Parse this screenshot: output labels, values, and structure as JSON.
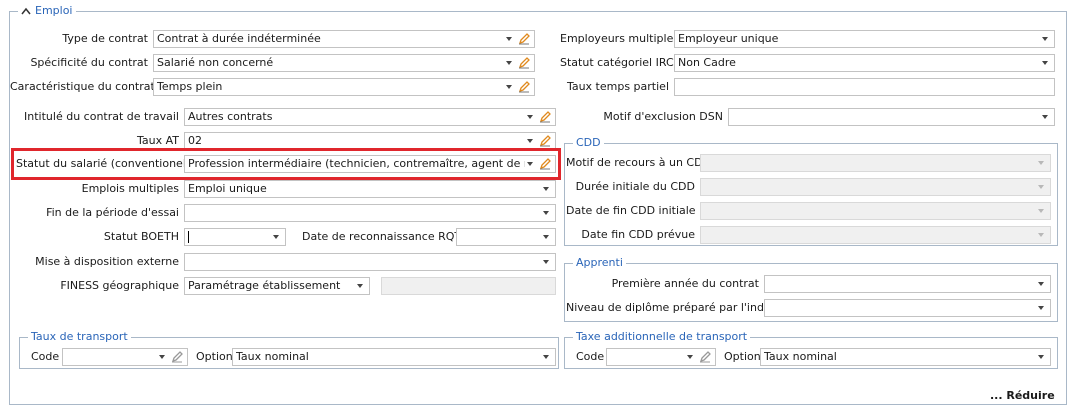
{
  "emploi": {
    "legend": "Emploi",
    "type_contrat": {
      "label": "Type de contrat",
      "value": "Contrat à durée indéterminée"
    },
    "specificite": {
      "label": "Spécificité du contrat",
      "value": "Salarié non concerné"
    },
    "caracteristique": {
      "label": "Caractéristique du contrat",
      "value": "Temps plein"
    },
    "intitule": {
      "label": "Intitulé du contrat de travail",
      "value": "Autres contrats"
    },
    "taux_at": {
      "label": "Taux AT",
      "value": "02"
    },
    "statut_salarie": {
      "label": "Statut du salarié (conventionel)",
      "value": "Profession intermédiaire (technicien, contremaître, agent de maîtrise, c"
    },
    "emplois_multiples": {
      "label": "Emplois multiples",
      "value": "Emploi unique"
    },
    "fin_periode_essai": {
      "label": "Fin de la période d'essai",
      "value": ""
    },
    "statut_boeth": {
      "label": "Statut BOETH",
      "value": ""
    },
    "date_rqth": {
      "label": "Date de reconnaissance RQTH",
      "value": ""
    },
    "mise_disposition": {
      "label": "Mise à disposition externe",
      "value": ""
    },
    "finess": {
      "label": "FINESS géographique",
      "value": "Paramétrage établissement"
    },
    "employeurs_multiples": {
      "label": "Employeurs multiples",
      "value": "Employeur unique"
    },
    "statut_irc": {
      "label": "Statut catégoriel IRC",
      "value": "Non Cadre"
    },
    "taux_temps_partiel": {
      "label": "Taux temps partiel",
      "value": ""
    },
    "motif_exclusion": {
      "label": "Motif d'exclusion DSN",
      "value": ""
    }
  },
  "cdd": {
    "legend": "CDD",
    "motif_recours": "Motif de recours à un CDD",
    "duree_initiale": "Durée initiale du CDD",
    "date_fin_initiale": "Date de fin CDD initiale",
    "date_fin_prevue": "Date fin CDD prévue"
  },
  "apprenti": {
    "legend": "Apprenti",
    "premiere_annee": "Première année du contrat",
    "niveau_diplome": "Niveau de diplôme préparé par l'individu"
  },
  "taux_transport": {
    "legend": "Taux de transport",
    "code_label": "Code",
    "code_value": "",
    "option_label": "Option",
    "option_value": "Taux nominal"
  },
  "taxe_transport": {
    "legend": "Taxe additionnelle de transport",
    "code_label": "Code",
    "code_value": "",
    "option_label": "Option",
    "option_value": "Taux nominal"
  },
  "reduire_label": "... Réduire",
  "colors": {
    "accent": "#2a65b8",
    "highlight": "#e0262c",
    "pencil": "#e08a1e"
  }
}
